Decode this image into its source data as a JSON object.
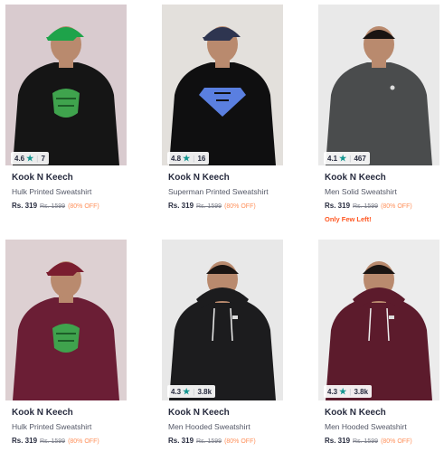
{
  "products": [
    {
      "brand": "Kook N Keech",
      "title": "Hulk Printed Sweatshirt",
      "price": "Rs. 319",
      "mrp": "Rs. 1599",
      "discount": "(80% OFF)",
      "rating": "4.6",
      "count": "7",
      "note": "",
      "bg": "#d9cbcf",
      "shirt": "#151515",
      "cap": "#1ea34a",
      "print": "hulk"
    },
    {
      "brand": "Kook N Keech",
      "title": "Superman Printed Sweatshirt",
      "price": "Rs. 319",
      "mrp": "Rs. 1599",
      "discount": "(80% OFF)",
      "rating": "4.8",
      "count": "16",
      "note": "",
      "bg": "#e3e0dc",
      "shirt": "#0f0f10",
      "cap": "#2e3550",
      "print": "superman"
    },
    {
      "brand": "Kook N Keech",
      "title": "Men Solid Sweatshirt",
      "price": "Rs. 319",
      "mrp": "Rs. 1599",
      "discount": "(80% OFF)",
      "rating": "4.1",
      "count": "467",
      "note": "Only Few Left!",
      "bg": "#e9e9e9",
      "shirt": "#4a4c4d",
      "cap": "",
      "print": "logo"
    },
    {
      "brand": "Kook N Keech",
      "title": "Hulk Printed Sweatshirt",
      "price": "Rs. 319",
      "mrp": "Rs. 1599",
      "discount": "(80% OFF)",
      "rating": "",
      "count": "",
      "note": "",
      "bg": "#ddd0d2",
      "shirt": "#6b1e35",
      "cap": "#7a1d2f",
      "print": "hulk"
    },
    {
      "brand": "Kook N Keech",
      "title": "Men Hooded Sweatshirt",
      "price": "Rs. 319",
      "mrp": "Rs. 1599",
      "discount": "(80% OFF)",
      "rating": "4.3",
      "count": "3.8k",
      "note": "",
      "bg": "#e8e8e8",
      "shirt": "#1c1c1e",
      "cap": "",
      "print": "hoodie"
    },
    {
      "brand": "Kook N Keech",
      "title": "Men Hooded Sweatshirt",
      "price": "Rs. 319",
      "mrp": "Rs. 1599",
      "discount": "(80% OFF)",
      "rating": "4.3",
      "count": "3.8k",
      "note": "",
      "bg": "#ececec",
      "shirt": "#5c1b2c",
      "cap": "",
      "print": "hoodie"
    }
  ]
}
